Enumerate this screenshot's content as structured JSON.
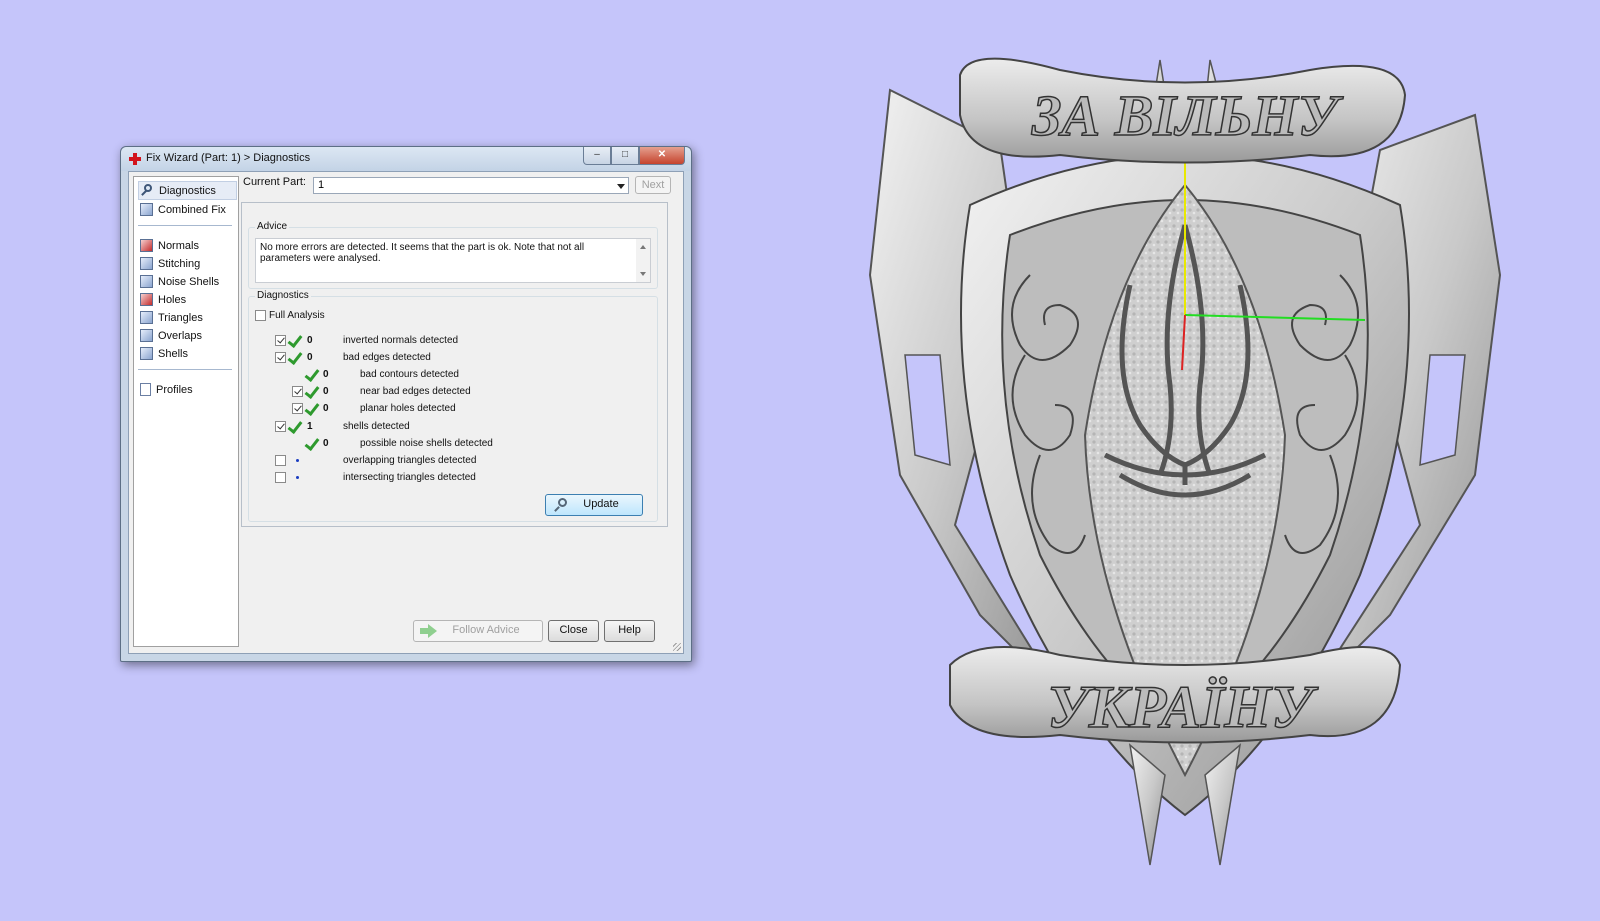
{
  "window": {
    "title": "Fix Wizard (Part: 1) > Diagnostics",
    "minimize_glyph": "–",
    "maximize_glyph": "□",
    "close_glyph": "✕"
  },
  "nav": {
    "items": [
      {
        "label": "Diagnostics",
        "icon": "magnifier-icon"
      },
      {
        "label": "Combined Fix",
        "icon": "cube-icon"
      },
      {
        "label": "Normals",
        "icon": "cube-red-icon"
      },
      {
        "label": "Stitching",
        "icon": "cube-icon"
      },
      {
        "label": "Noise Shells",
        "icon": "cube-icon"
      },
      {
        "label": "Holes",
        "icon": "cube-red-icon"
      },
      {
        "label": "Triangles",
        "icon": "cube-icon"
      },
      {
        "label": "Overlaps",
        "icon": "cube-icon"
      },
      {
        "label": "Shells",
        "icon": "cube-icon"
      },
      {
        "label": "Profiles",
        "icon": "document-icon"
      }
    ]
  },
  "current_part": {
    "label": "Current Part:",
    "value": "1",
    "next_label": "Next"
  },
  "advice": {
    "title": "Advice",
    "text": "No more errors are detected. It seems that the part is ok. Note that not all parameters were analysed."
  },
  "diagnostics": {
    "title": "Diagnostics",
    "full_analysis_label": "Full Analysis",
    "rows": [
      {
        "count": "0",
        "label": "inverted normals detected"
      },
      {
        "count": "0",
        "label": "bad edges detected"
      },
      {
        "count": "0",
        "label": "bad contours detected"
      },
      {
        "count": "0",
        "label": "near bad edges detected"
      },
      {
        "count": "0",
        "label": "planar holes detected"
      },
      {
        "count": "1",
        "label": "shells detected"
      },
      {
        "count": "0",
        "label": "possible noise shells detected"
      },
      {
        "count": "",
        "label": "overlapping triangles detected"
      },
      {
        "count": "",
        "label": "intersecting triangles detected"
      }
    ],
    "update_label": "Update"
  },
  "footer": {
    "follow_advice_label": "Follow Advice",
    "close_label": "Close",
    "help_label": "Help"
  },
  "model": {
    "top_text": "ЗА ВІЛЬНУ",
    "bottom_text": "УКРАЇНУ"
  },
  "colors": {
    "background": "#c5c5fa",
    "accent_check": "#2e9a2e",
    "axis_y": "#e8e800",
    "axis_x": "#22dd22",
    "axis_z": "#dd2222"
  }
}
